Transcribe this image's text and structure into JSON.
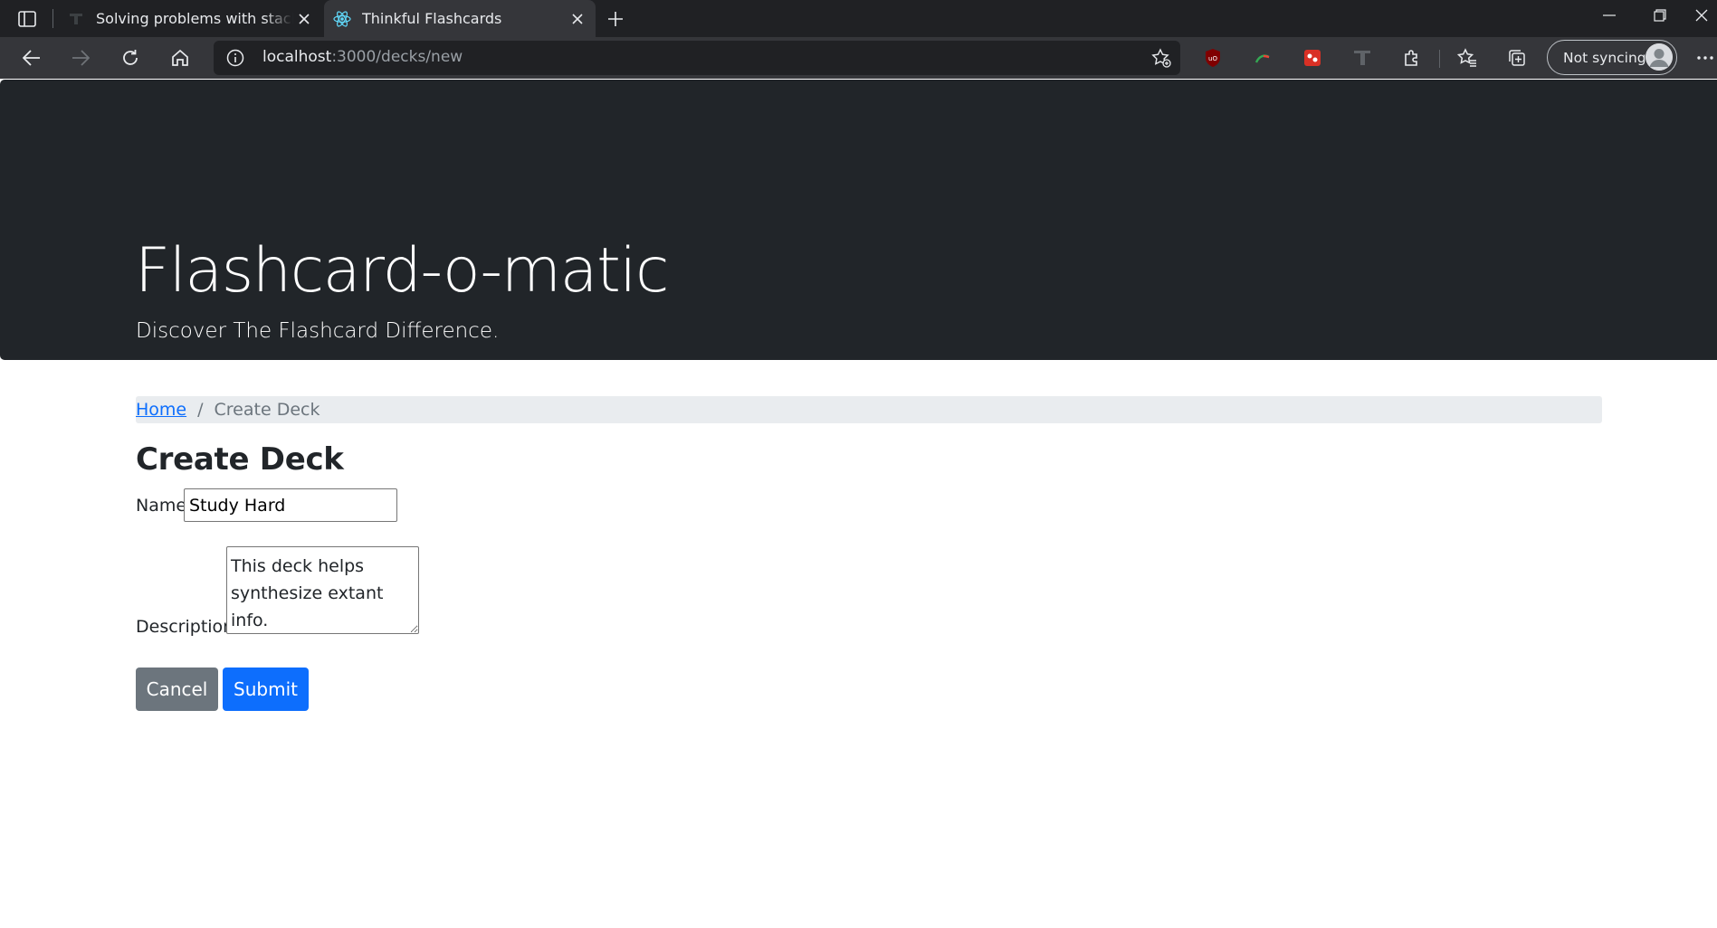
{
  "browser": {
    "tabs": [
      {
        "title": "Solving problems with stacks and",
        "active": false,
        "icon": "thinkful-icon"
      },
      {
        "title": "Thinkful Flashcards",
        "active": true,
        "icon": "react-icon"
      }
    ],
    "address": {
      "host": "localhost",
      "path": ":3000/decks/new"
    },
    "profile_label": "Not syncing"
  },
  "header": {
    "title": "Flashcard-o-matic",
    "subtitle": "Discover The Flashcard Difference."
  },
  "breadcrumb": {
    "home": "Home",
    "separator": "/",
    "current": "Create Deck"
  },
  "form": {
    "heading": "Create Deck",
    "name_label": "Name",
    "name_value": "Study Hard",
    "description_label": "Description",
    "description_value": "This deck helps synthesize extant info.",
    "cancel_label": "Cancel",
    "submit_label": "Submit"
  },
  "colors": {
    "jumbotron": "#212529",
    "primary": "#0d6efd",
    "secondary": "#6c757d",
    "breadcrumb_bg": "#e9ecef"
  }
}
